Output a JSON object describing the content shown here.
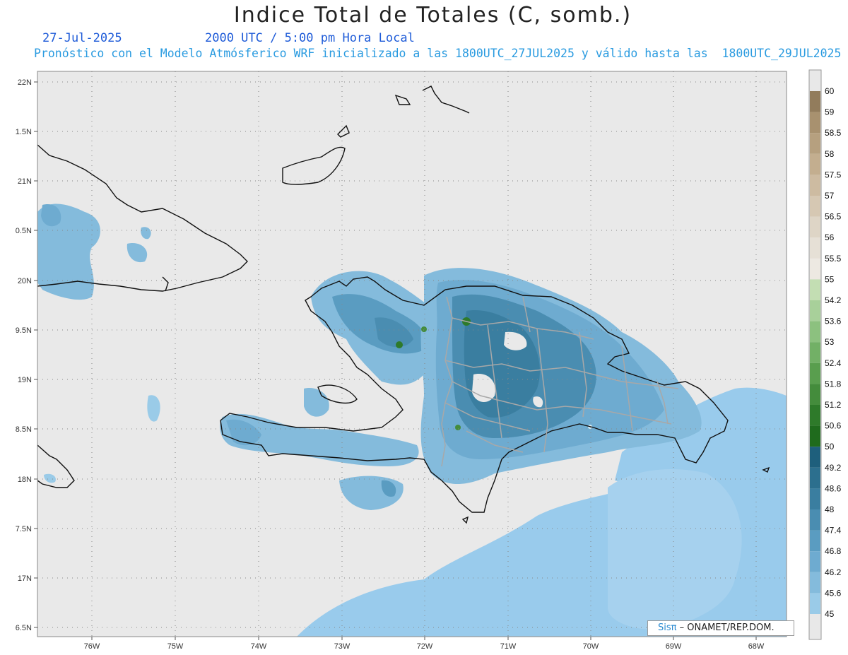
{
  "header": {
    "title": "Indice Total de Totales (C, somb.)",
    "date": "27-Jul-2025",
    "time": "2000 UTC / 5:00 pm Hora Local",
    "description": "Pronóstico con el Modelo Atmósferico WRF inicializado a las 1800UTC_27JUL2025 y válido hasta las  1800UTC_29JUL2025"
  },
  "map": {
    "lat_labels": [
      "22N",
      "1.5N",
      "21N",
      "0.5N",
      "20N",
      "9.5N",
      "19N",
      "8.5N",
      "18N",
      "7.5N",
      "17N",
      "6.5N"
    ],
    "lon_labels": [
      "76W",
      "75W",
      "74W",
      "73W",
      "72W",
      "71W",
      "70W",
      "69W",
      "68W"
    ],
    "background_color": "#e9e9e9"
  },
  "colorbar": {
    "labels": [
      "60",
      "59",
      "58.5",
      "58",
      "57.5",
      "57",
      "56.5",
      "56",
      "55.5",
      "55",
      "54.2",
      "53.6",
      "53",
      "52.4",
      "51.8",
      "51.2",
      "50.6",
      "50",
      "49.2",
      "48.6",
      "48",
      "47.4",
      "46.8",
      "46.2",
      "45.6",
      "45"
    ],
    "colors": [
      "#927c5c",
      "#a8916f",
      "#b6a07f",
      "#c3ae8f",
      "#cdbba1",
      "#d6c8b3",
      "#ded5c6",
      "#e6e0d6",
      "#ede9e2",
      "#c3deb3",
      "#a8d09a",
      "#8cc17f",
      "#72b066",
      "#599e4e",
      "#448c3c",
      "#2e7a2a",
      "#1f6b1d",
      "#1e5f7c",
      "#2c6f8e",
      "#3a7ea0",
      "#4a8db1",
      "#5a9cc1",
      "#6eabd0",
      "#84bbdc",
      "#9acbe8"
    ]
  },
  "credit": {
    "logo": "Sisπ",
    "text": "– ONAMET/REP.DOM."
  }
}
